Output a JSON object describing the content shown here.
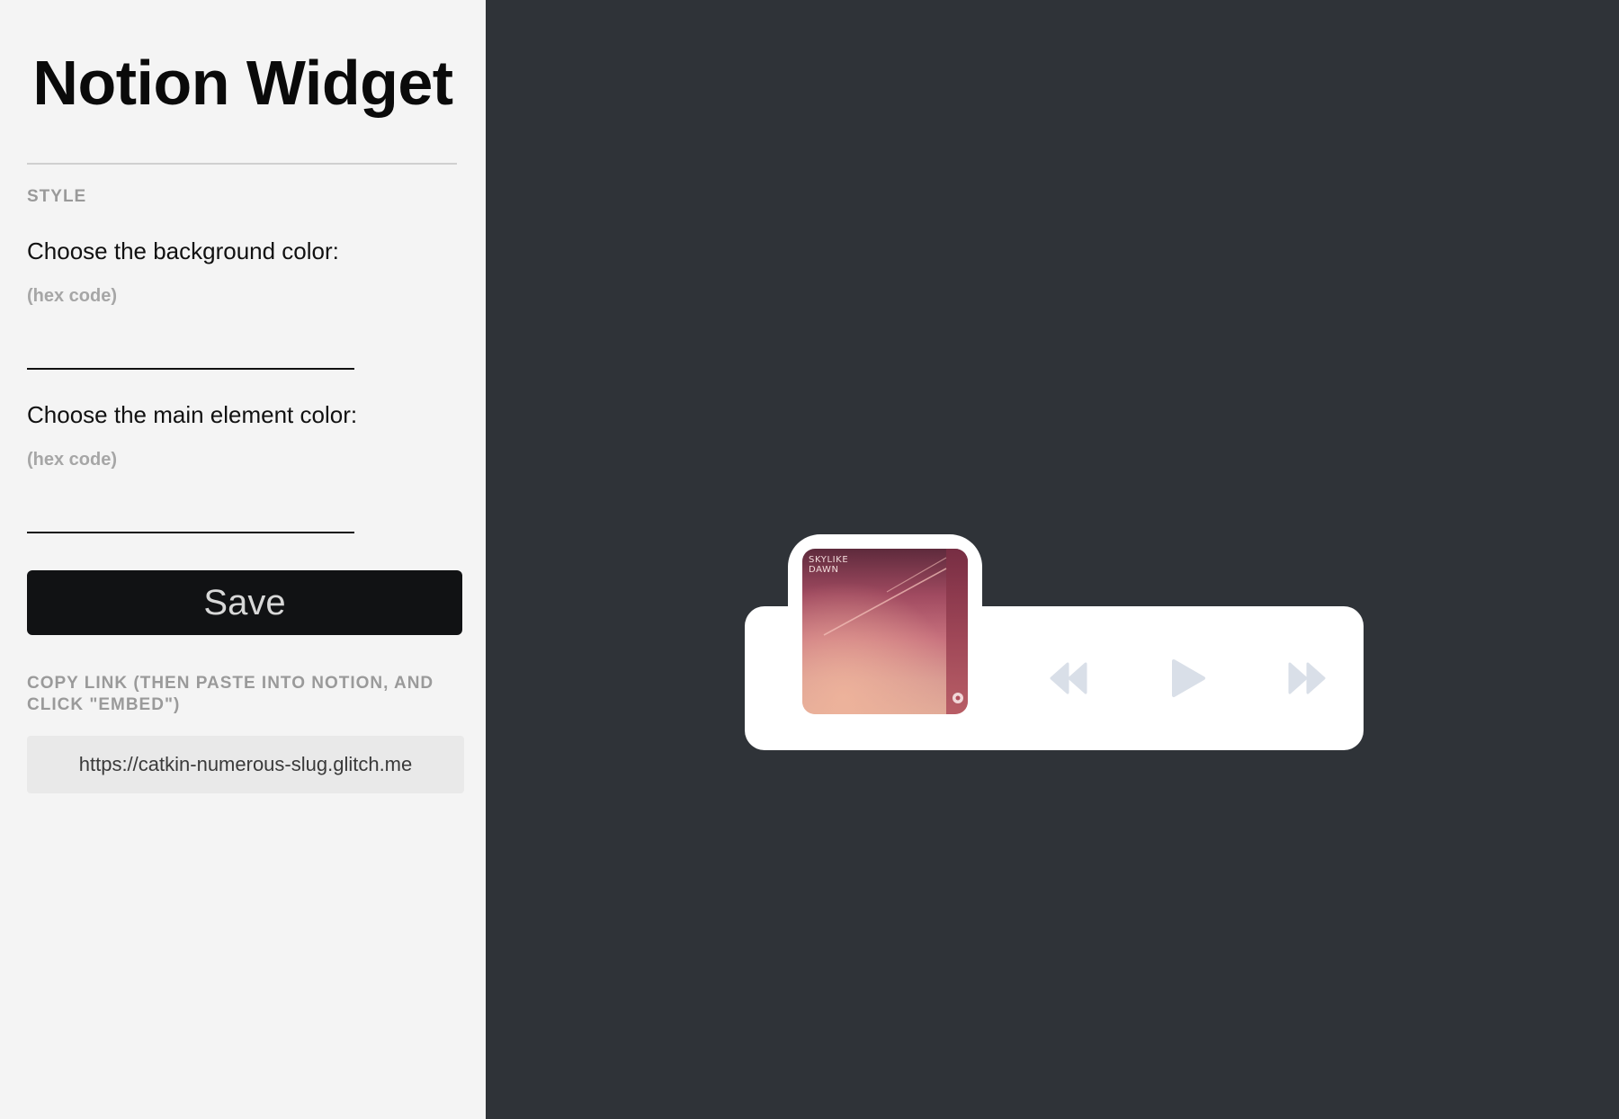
{
  "sidebar": {
    "title": "Notion Widget",
    "style_section_label": "STYLE",
    "background_color": {
      "label": "Choose the background color:",
      "hint": "(hex code)",
      "value": ""
    },
    "main_color": {
      "label": "Choose the main element color:",
      "hint": "(hex code)",
      "value": ""
    },
    "save_label": "Save",
    "copy_label": "COPY LINK (THEN PASTE INTO NOTION, AND CLICK \"EMBED\")",
    "link_url": "https://catkin-numerous-slug.glitch.me"
  },
  "player": {
    "album": {
      "line1": "SKYLIKE",
      "line2": "DAWN"
    },
    "controls": {
      "previous_icon": "rewind-icon",
      "play_icon": "play-icon",
      "next_icon": "fast-forward-icon"
    }
  },
  "colors": {
    "sidebar_bg": "#f4f4f4",
    "preview_bg": "#2f3338",
    "player_bg": "#ffffff",
    "control_color": "#d9dfe8",
    "save_button_bg": "#111214"
  }
}
